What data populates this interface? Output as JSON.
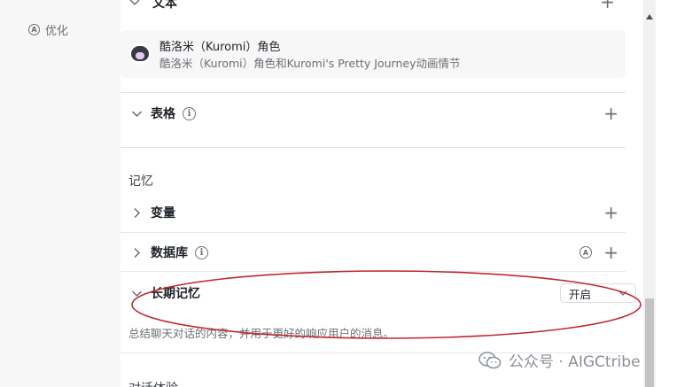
{
  "nav": {
    "optimize_label": "优化",
    "optimize_icon": "circle-a-icon"
  },
  "top_cut": {
    "label": "文本"
  },
  "character": {
    "title": "酷洛米（Kuromi）角色",
    "description": "酷洛米（Kuromi）角色和Kuromi's Pretty Journey动画情节",
    "avatar_icon": "kuromi-avatar-icon"
  },
  "table_row": {
    "label": "表格",
    "expanded": true
  },
  "memory": {
    "section_label": "记忆",
    "variables_label": "变量",
    "database_label": "数据库",
    "long_term": {
      "label": "长期记忆",
      "toggle_value": "开启",
      "description": "总结聊天对话的内容，并用于更好的响应用户的消息。"
    }
  },
  "next_section_label": "对话体验",
  "watermark": {
    "text": "公众号 · AIGCtribe",
    "icon": "wechat-icon"
  },
  "colors": {
    "annotation": "#c0282d",
    "panel": "#ffffff",
    "background": "#f7f7f8"
  }
}
